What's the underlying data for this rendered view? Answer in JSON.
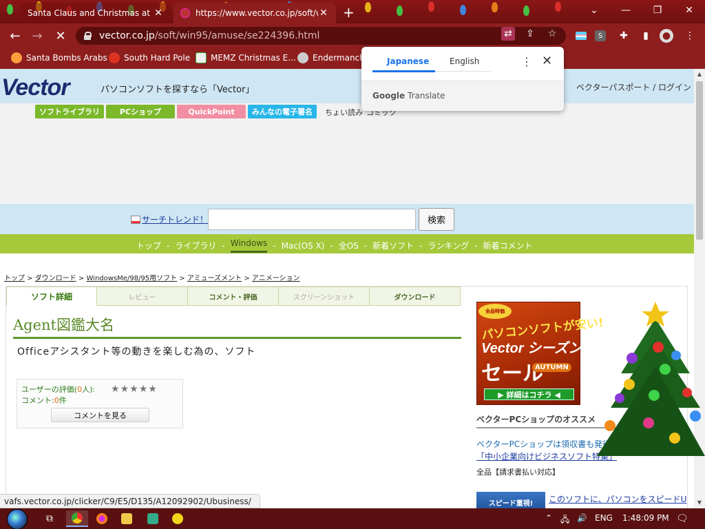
{
  "browser": {
    "tabs": [
      {
        "title": "Santa Claus and Christmas at the"
      },
      {
        "title": "https://www.vector.co.jp/soft/win"
      }
    ],
    "url_host": "vector.co.jp",
    "url_path": "/soft/win95/amuse/se224396.html",
    "extension_label": "S",
    "bookmarks": [
      "Santa Bombs Arabs",
      "South Hard Pole",
      "MEMZ Christmas E...",
      "Endermanch"
    ]
  },
  "translate_popup": {
    "tab_source": "Japanese",
    "tab_target": "English",
    "footer_brand": "Google",
    "footer_text": "Translate"
  },
  "header": {
    "logo": "Vector",
    "slogan": "パソコンソフトを探すなら「Vector」",
    "passport": "ベクターパスポート / ログイン"
  },
  "top_buttons": [
    {
      "label": "ソフトライブラリ",
      "color": "#7bb82a"
    },
    {
      "label": "PCショップ",
      "color": "#7bb82a"
    },
    {
      "label": "QuickPoint",
      "color": "#f28ea3"
    },
    {
      "label": "みんなの電子署名",
      "color": "#28b6e8"
    }
  ],
  "top_links": [
    "ちょい読み",
    "コミック"
  ],
  "search": {
    "trend_label": "サーチトレンド！",
    "input_value": "",
    "button_label": "検索"
  },
  "global_nav": [
    "トップ",
    "ライブラリ",
    "Windows",
    "Mac(OS X)",
    "全OS",
    "新着ソフト",
    "ランキング",
    "新着コメント"
  ],
  "global_nav_active": "Windows",
  "breadcrumb": [
    "トップ",
    "ダウンロード",
    "WindowsMe/98/95用ソフト",
    "アミューズメント",
    "アニメーション"
  ],
  "page_tabs": [
    "ソフト詳細",
    "レビュー",
    "コメント・評価",
    "スクリーンショット",
    "ダウンロード"
  ],
  "software": {
    "title": "Agent図鑑大名",
    "description": "Officeアシスタント等の動きを楽しむ為の、ソフト"
  },
  "rating": {
    "user_label": "ユーザーの評価(",
    "user_count": "0",
    "user_suffix": "人):",
    "comment_label": "コメント:",
    "comment_count": "0",
    "comment_suffix": "件",
    "stars": 0,
    "button": "コメントを見る"
  },
  "sidebar": {
    "ad": {
      "badge": "全品特価",
      "line1": "パソコンソフトが安い!",
      "line2": "Vector シーズン",
      "line3": "セール",
      "season": "AUTUMN",
      "cta": "▶ 詳細はコチラ ◀"
    },
    "shop_heading": "ベクターPCショップのオススメ",
    "shop_line1": "ベクターPCショップは領収書も発行",
    "shop_link": "「中小企業向けビジネスソフト特集」",
    "shop_line3": "全品【請求書払い対応】",
    "speed_banner": "スピード重視!",
    "speed_link": "このソフトに、パソコンをスピードU"
  },
  "status_url": "vafs.vector.co.jp/clicker/C9/E5/D135/A12092902/Ubusiness/",
  "taskbar": {
    "lang": "ENG",
    "time": "1:48:09 PM"
  }
}
